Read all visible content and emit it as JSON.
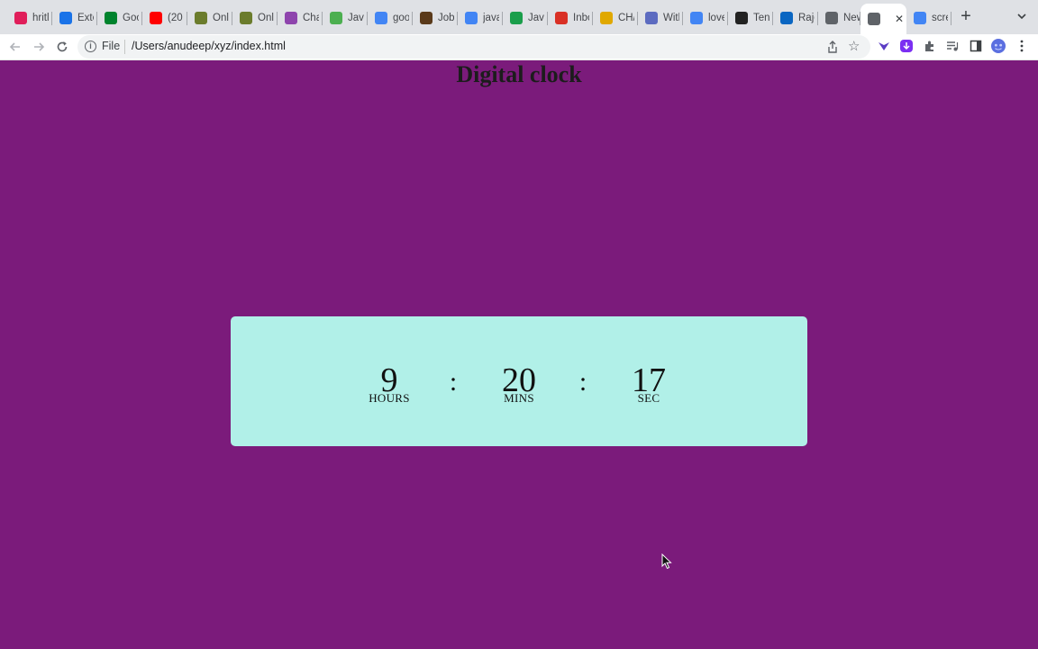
{
  "browser": {
    "tabs": [
      {
        "title": "hritl",
        "icon": "slack-icon",
        "color": "#e01e5a"
      },
      {
        "title": "Exte",
        "icon": "puzzle-icon",
        "color": "#1a73e8"
      },
      {
        "title": "Goo",
        "icon": "google-meet-icon",
        "color": "#00832d"
      },
      {
        "title": "(20",
        "icon": "youtube-icon",
        "color": "#ff0000"
      },
      {
        "title": "Onli",
        "icon": "map-pin-icon",
        "color": "#6b7c2c"
      },
      {
        "title": "Onli",
        "icon": "map-pin-icon",
        "color": "#6b7c2c"
      },
      {
        "title": "Cha",
        "icon": "chat-icon",
        "color": "#8e44ad"
      },
      {
        "title": "Jav",
        "icon": "mountain-icon",
        "color": "#4caf50"
      },
      {
        "title": "goo",
        "icon": "google-icon",
        "color": "#4285f4"
      },
      {
        "title": "Job",
        "icon": "briefcase-icon",
        "color": "#5a3a1a"
      },
      {
        "title": "java",
        "icon": "google-icon",
        "color": "#4285f4"
      },
      {
        "title": "Java",
        "icon": "w-icon",
        "color": "#1a9e4b"
      },
      {
        "title": "Inbo",
        "icon": "gmail-icon",
        "color": "#d93025"
      },
      {
        "title": "CH/",
        "icon": "pen-icon",
        "color": "#e0a800"
      },
      {
        "title": "With",
        "icon": "compass-icon",
        "color": "#5c6bc0"
      },
      {
        "title": "love",
        "icon": "google-icon",
        "color": "#4285f4"
      },
      {
        "title": "Ten",
        "icon": "fa-icon",
        "color": "#222222"
      },
      {
        "title": "Rajo",
        "icon": "linkedin-icon",
        "color": "#0a66c2"
      },
      {
        "title": "New",
        "icon": "chrome-icon",
        "color": "#5f6368"
      },
      {
        "title": "",
        "icon": "globe-icon",
        "color": "#5f6368",
        "active": true
      },
      {
        "title": "scre",
        "icon": "google-icon",
        "color": "#4285f4"
      }
    ],
    "new_tab": "+",
    "address": {
      "scheme": "File",
      "url": "/Users/anudeep/xyz/index.html"
    }
  },
  "page": {
    "heading": "Digital clock",
    "clock": {
      "hours": "9",
      "hours_label": "HOURS",
      "minutes": "20",
      "minutes_label": "MINS",
      "seconds": "17",
      "seconds_label": "SEC",
      "separator": ":"
    }
  },
  "colors": {
    "page_background": "#7b1b7b",
    "card_background": "#b1f0e8",
    "heading_text": "#1c1c1c"
  }
}
